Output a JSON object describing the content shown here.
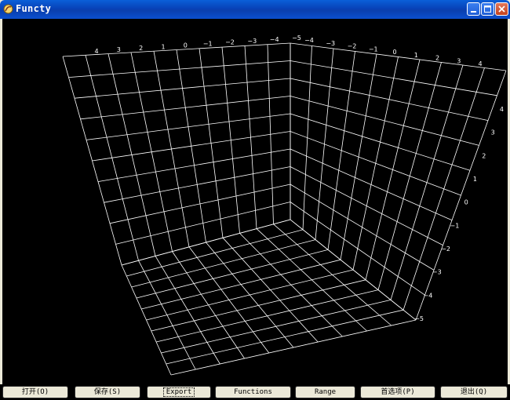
{
  "window": {
    "title": "Functy",
    "title_color": "#ffffff",
    "titlebar_color": "#0842b8"
  },
  "plot": {
    "background": "#000000",
    "grid_color": "#ffffff",
    "left_wall_x_ticks": [
      "4",
      "3",
      "2",
      "1",
      "0",
      "−1",
      "−2",
      "−3",
      "−4",
      "−5"
    ],
    "right_wall_y_ticks": [
      "−4",
      "−3",
      "−2",
      "−1",
      "0",
      "1",
      "2",
      "3",
      "4"
    ],
    "right_edge_z_ticks": [
      "4",
      "3",
      "2",
      "1",
      "0",
      "−1",
      "−2",
      "−3",
      "−4",
      "−5"
    ]
  },
  "toolbar": {
    "buttons": [
      {
        "label": "打开(O)"
      },
      {
        "label": "保存(S)"
      },
      {
        "label": "Export"
      },
      {
        "label": "Functions"
      },
      {
        "label": "Range"
      },
      {
        "label": "首选项(P)"
      },
      {
        "label": "退出(Q)"
      }
    ]
  }
}
